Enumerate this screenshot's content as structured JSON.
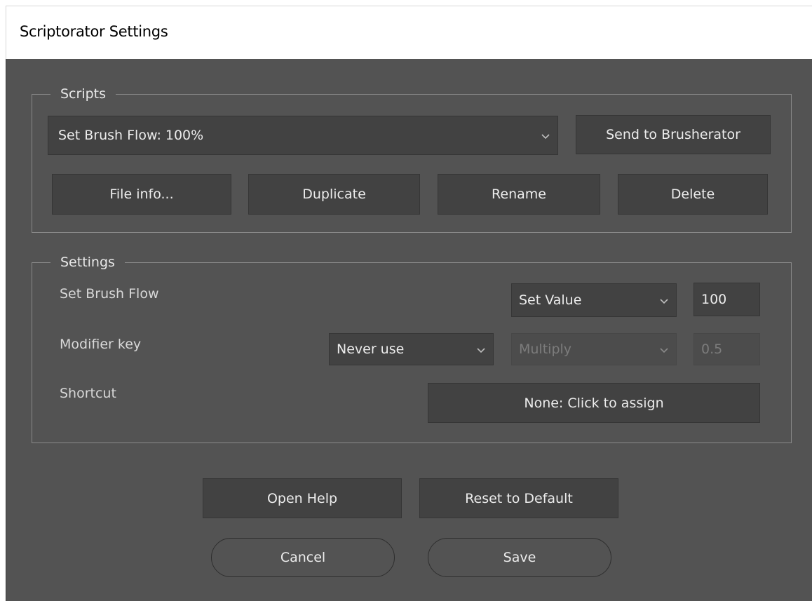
{
  "window": {
    "title": "Scriptorator Settings"
  },
  "scripts_group": {
    "title": "Scripts",
    "selected_script": "Set Brush Flow: 100%",
    "send_button": "Send to Brusherator",
    "file_info_button": "File info...",
    "duplicate_button": "Duplicate",
    "rename_button": "Rename",
    "delete_button": "Delete"
  },
  "settings_group": {
    "title": "Settings",
    "brush_flow_label": "Set Brush Flow",
    "mode_value": "Set Value",
    "flow_value": "100",
    "modifier_label": "Modifier key",
    "modifier_value": "Never use",
    "modifier_op_value": "Multiply",
    "modifier_amount": "0.5",
    "shortcut_label": "Shortcut",
    "shortcut_button": "None: Click to assign"
  },
  "footer": {
    "open_help": "Open Help",
    "reset_default": "Reset to Default",
    "cancel": "Cancel",
    "save": "Save"
  },
  "icons": {
    "dropdown": "chevron-down-icon"
  },
  "colors": {
    "panel_bg": "#535353",
    "control_bg": "#424242",
    "text": "#ececec",
    "disabled_text": "#7c7c7c"
  }
}
